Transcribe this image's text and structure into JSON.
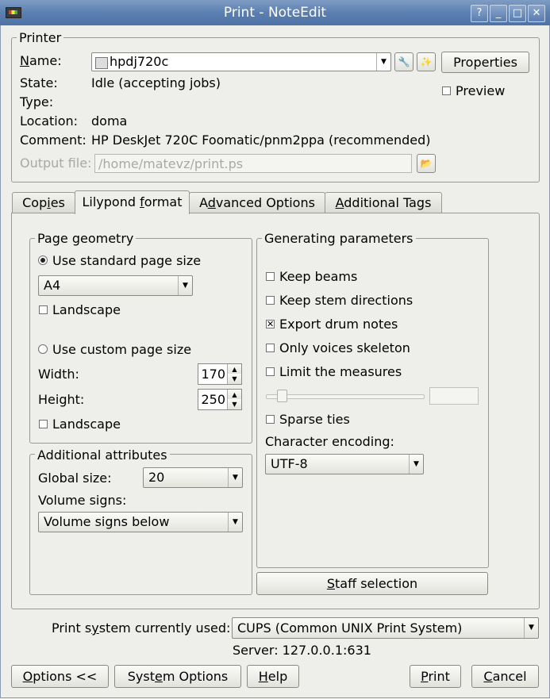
{
  "window": {
    "title": "Print - NoteEdit",
    "help": "?",
    "minimize": "_",
    "maximize": "□",
    "close": "✕"
  },
  "printer": {
    "legend": "Printer",
    "name_label": "Name:",
    "name_value": "hpdj720c",
    "properties_button": "Properties",
    "preview_label": "Preview",
    "state_label": "State:",
    "state_value": "Idle (accepting jobs)",
    "type_label": "Type:",
    "type_value": "",
    "location_label": "Location:",
    "location_value": "doma",
    "comment_label": "Comment:",
    "comment_value": "HP DeskJet 720C Foomatic/pnm2ppa (recommended)",
    "output_label": "Output file:",
    "output_value": "/home/matevz/print.ps"
  },
  "tabs": [
    "Copies",
    "Lilypond format",
    "Advanced Options",
    "Additional Tags"
  ],
  "page_geometry": {
    "legend": "Page geometry",
    "standard_label": "Use standard page size",
    "standard_value": "A4",
    "landscape1": "Landscape",
    "custom_label": "Use custom page size",
    "width_label": "Width:",
    "width_value": "170",
    "height_label": "Height:",
    "height_value": "250",
    "landscape2": "Landscape"
  },
  "additional": {
    "legend": "Additional attributes",
    "global_label": "Global size:",
    "global_value": "20",
    "volume_label": "Volume signs:",
    "volume_value": "Volume signs below"
  },
  "generating": {
    "legend": "Generating parameters",
    "keep_beams": "Keep beams",
    "keep_stem": "Keep stem directions",
    "export_drum": "Export drum notes",
    "only_voices": "Only voices skeleton",
    "limit_measures": "Limit the measures",
    "sparse_ties": "Sparse ties",
    "encoding_label": "Character encoding:",
    "encoding_value": "UTF-8",
    "staff_button": "Staff selection"
  },
  "system": {
    "label": "Print system currently used:",
    "value": "CUPS (Common UNIX Print System)",
    "server": "Server: 127.0.0.1:631"
  },
  "buttons": {
    "options": "Options <<",
    "system_options": "System Options",
    "help": "Help",
    "print": "Print",
    "cancel": "Cancel"
  }
}
